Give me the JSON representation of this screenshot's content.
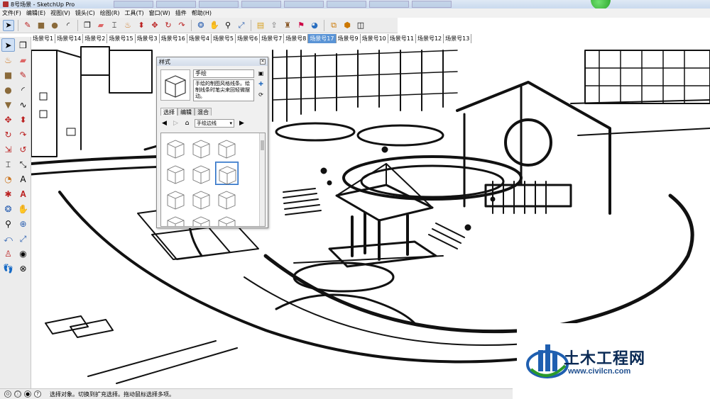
{
  "window": {
    "title": "8号场景 - SketchUp Pro"
  },
  "menu": {
    "items": [
      "文件(F)",
      "编辑(E)",
      "视图(V)",
      "镜头(C)",
      "绘图(R)",
      "工具(T)",
      "窗口(W)",
      "插件",
      "帮助(H)"
    ]
  },
  "scene_tabs": {
    "items": [
      "场景号1",
      "场景号14",
      "场景号2",
      "场景号15",
      "场景号3",
      "场景号16",
      "场景号4",
      "场景号5",
      "场景号6",
      "场景号7",
      "场景号8",
      "场景号17",
      "场景号9",
      "场景号10",
      "场景号11",
      "场景号12",
      "场景号13"
    ],
    "active_index": 11
  },
  "styles_panel": {
    "title": "样式",
    "style_name": "手绘",
    "description": "手绘的制图风格线条。绘制线条时笔尖来回轻微摆动。",
    "tabs": [
      "选择",
      "编辑",
      "混合"
    ],
    "active_tab": 0,
    "collection": "手绘边线",
    "selected_thumbnail": 5
  },
  "statusbar": {
    "text": "选择对象。切换到扩充选择。拖动鼠标选择多项。"
  },
  "watermark": {
    "name": "土木工程网",
    "url": "www.civilcn.com"
  },
  "colors": {
    "active_tab": "#5a94d6",
    "selection_border": "#2c6fc4",
    "watermark_blue": "#0a2a55"
  }
}
